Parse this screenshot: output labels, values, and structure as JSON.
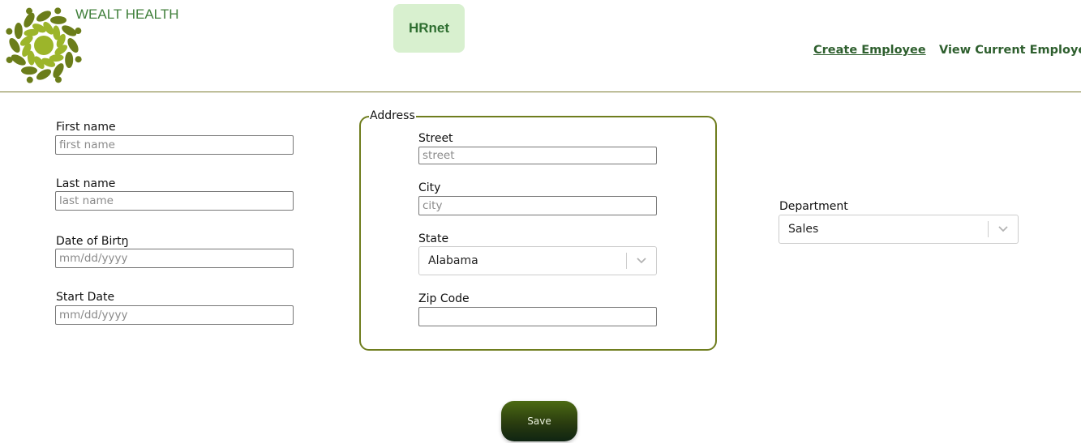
{
  "header": {
    "brand": "WEALT HEALTH",
    "app_name": "HRnet",
    "nav": {
      "create": "Create Employee",
      "view": "View Current Employees"
    },
    "colors": {
      "brand": "#3f7f3a",
      "logo_dark": "#6b7d1a",
      "logo_light": "#9cb52a",
      "badge_bg": "#d8f0cf"
    }
  },
  "form": {
    "first_name": {
      "label": "First name",
      "placeholder": "first name",
      "value": ""
    },
    "last_name": {
      "label": "Last name",
      "placeholder": "last name",
      "value": ""
    },
    "dob": {
      "label": "Date of Birtŋ",
      "placeholder": "mm/dd/yyyy",
      "value": ""
    },
    "start_date": {
      "label": "Start Date",
      "placeholder": "mm/dd/yyyy",
      "value": ""
    },
    "address": {
      "legend": "Address",
      "street": {
        "label": "Street",
        "placeholder": "street",
        "value": ""
      },
      "city": {
        "label": "City",
        "placeholder": "city",
        "value": ""
      },
      "state": {
        "label": "State",
        "selected": "Alabama"
      },
      "zip": {
        "label": "Zip Code",
        "placeholder": "",
        "value": ""
      }
    },
    "department": {
      "label": "Department",
      "selected": "Sales"
    },
    "save_label": "Save"
  },
  "icons": {
    "logo": "leaf-wreath-logo-icon",
    "dropdown": "chevron-down-icon"
  }
}
